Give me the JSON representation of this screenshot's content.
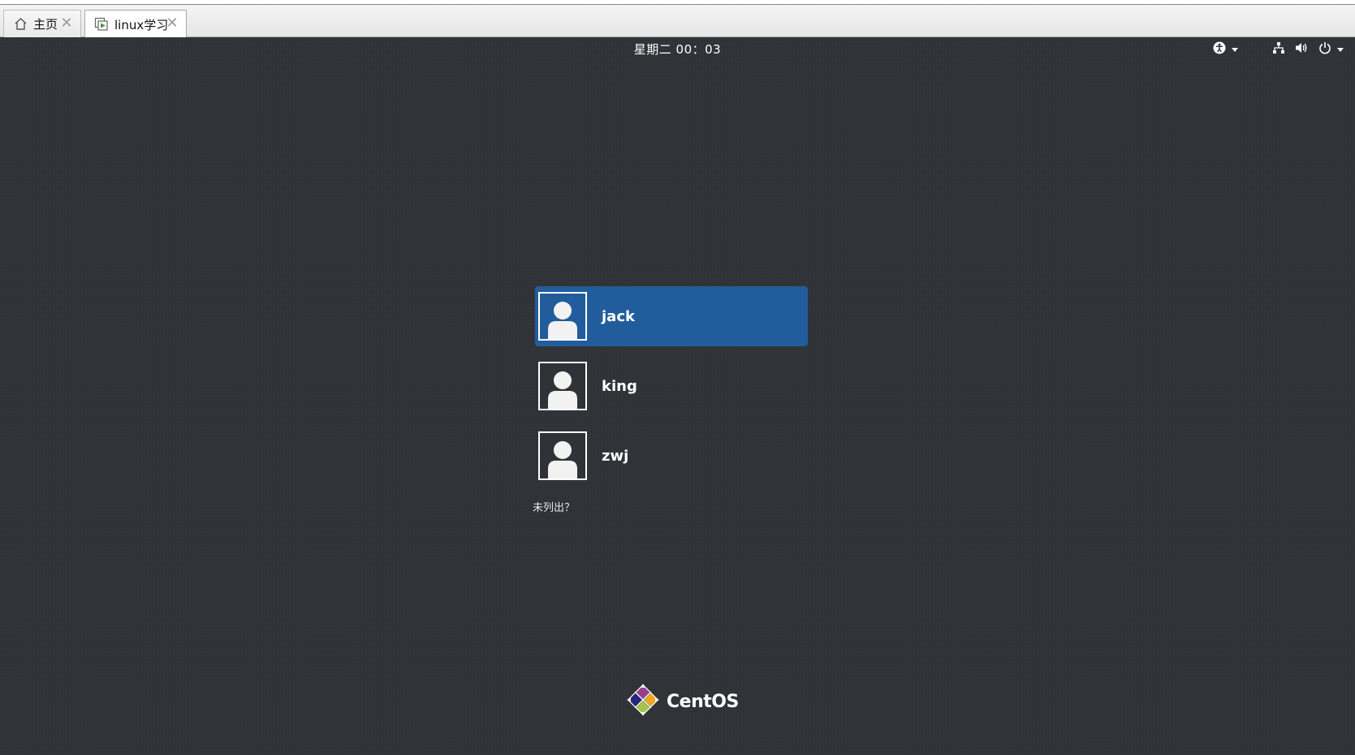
{
  "tabs": [
    {
      "label": "主页",
      "icon": "home-icon",
      "active": false
    },
    {
      "label": "linux学习",
      "icon": "vm-icon",
      "active": true
    }
  ],
  "greeter": {
    "clock": "星期二 00：03",
    "indicators": [
      "accessibility-icon",
      "network-icon",
      "volume-icon",
      "power-icon"
    ],
    "users": [
      {
        "name": "jack",
        "selected": true
      },
      {
        "name": "king",
        "selected": false
      },
      {
        "name": "zwj",
        "selected": false
      }
    ],
    "not_listed": "未列出？",
    "logo_text": "CentOS"
  }
}
